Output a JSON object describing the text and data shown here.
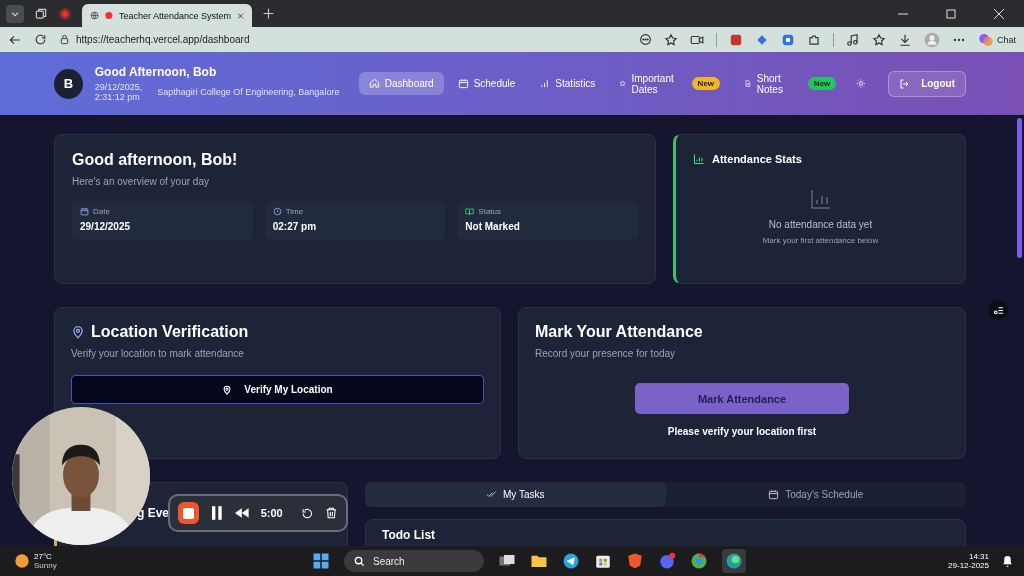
{
  "browser": {
    "tabs": [
      {
        "title": "Teacher Attendance System",
        "selected": true
      }
    ],
    "url": "https://teacherhq.vercel.app/dashboard",
    "chat": "Chat"
  },
  "header": {
    "avatar": "B",
    "greeting": "Good Afternoon, Bob",
    "datetime": "29/12/2025, 2:31:12 pm",
    "location": "Sapthagiri College Of Engineering, Bangalore",
    "nav": [
      {
        "label": "Dashboard",
        "selected": true
      },
      {
        "label": "Schedule",
        "selected": false
      },
      {
        "label": "Statistics",
        "selected": false
      },
      {
        "label": "Important Dates",
        "selected": false,
        "badge": "New",
        "color": "#f0b429"
      },
      {
        "label": "Short Notes",
        "selected": false,
        "badge": "New",
        "color": "#22c55e"
      }
    ],
    "logout": "Logout"
  },
  "welcome": {
    "title": "Good afternoon, Bob!",
    "subtitle": "Here's an overview of your day",
    "info": [
      {
        "label": "Date",
        "value": "29/12/2025"
      },
      {
        "label": "Time",
        "value": "02:27 pm"
      },
      {
        "label": "Status",
        "value": "Not Marked"
      }
    ]
  },
  "stats": {
    "title": "Attendance Stats",
    "empty_title": "No attendance data yet",
    "empty_hint": "Mark your first attendance below"
  },
  "location": {
    "title": "Location Verification",
    "subtitle": "Verify your location to mark attendance",
    "button": "Verify My Location"
  },
  "mark": {
    "title": "Mark Your Attendance",
    "subtitle": "Record your presence for today",
    "button": "Mark Attendance",
    "disabled": true,
    "hint": "Please verify your location first"
  },
  "events": {
    "title": "g Eve"
  },
  "tabs": [
    {
      "label": "My Tasks",
      "selected": true
    },
    {
      "label": "Today's Schedule",
      "selected": false
    }
  ],
  "todo": {
    "title": "Todo List"
  },
  "recorder": {
    "time": "5:00"
  },
  "taskbar": {
    "temperature": "27°C",
    "condition": "Sunny",
    "search": "Search",
    "time": "14:31",
    "date": "29-12-2025"
  }
}
